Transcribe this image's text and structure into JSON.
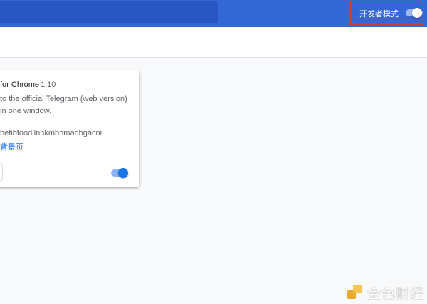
{
  "header": {
    "dev_mode_label": "开发者模式",
    "dev_mode_enabled": true
  },
  "extension": {
    "name": "for Chrome",
    "version": "1.10",
    "description": "to the official Telegram (web version) in one window.",
    "id": "befibfoodilnhkmbhmadbgacni",
    "view_link": "背景页",
    "enabled": true
  },
  "watermark": {
    "text": "金色财经"
  },
  "colors": {
    "header_bg": "#3367d6",
    "accent": "#1a73e8",
    "highlight_border": "#d93a30"
  }
}
